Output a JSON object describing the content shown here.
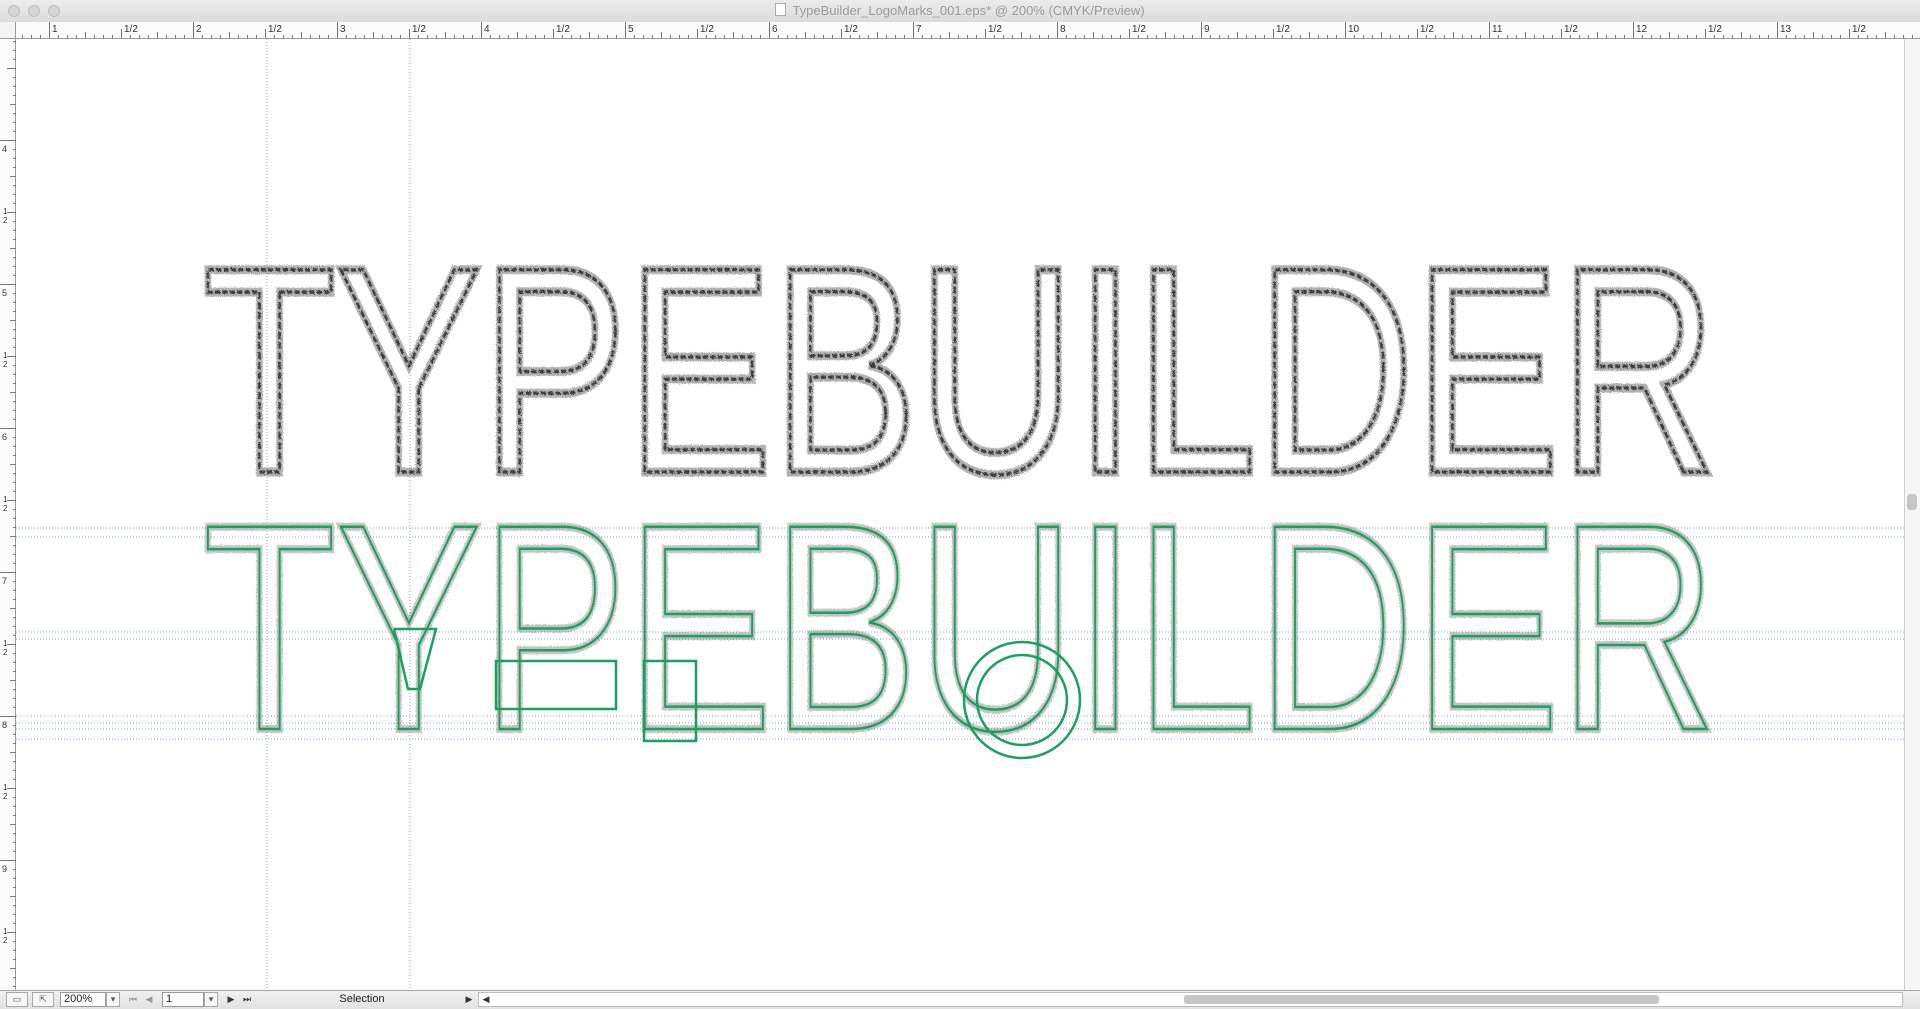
{
  "window": {
    "title": "TypeBuilder_LogoMarks_001.eps* @ 200% (CMYK/Preview)"
  },
  "rulers": {
    "horizontal_units": [
      "1",
      "2",
      "3",
      "4",
      "5",
      "6",
      "7",
      "8",
      "9",
      "10",
      "11",
      "12",
      "13"
    ],
    "half_label": "1/2",
    "vertical_units": [
      "4",
      "5",
      "6",
      "7",
      "8",
      "9"
    ],
    "vertical_half_label": "1 2"
  },
  "artwork": {
    "sketch_text": "TYPEBUILDER",
    "construction_text": "TYPEBUILDER",
    "sketch_color": "#3a3a3a",
    "construction_color": "#1f9e5e",
    "guide_color": "#5b9bd5"
  },
  "statusbar": {
    "zoom": "200%",
    "artboard": "1",
    "tool": "Selection"
  },
  "icons": {
    "doc": "document-icon",
    "first": "first-artboard-icon",
    "prev": "prev-artboard-icon",
    "next": "next-artboard-icon",
    "last": "last-artboard-icon",
    "dropdown": "chevron-down-icon"
  }
}
